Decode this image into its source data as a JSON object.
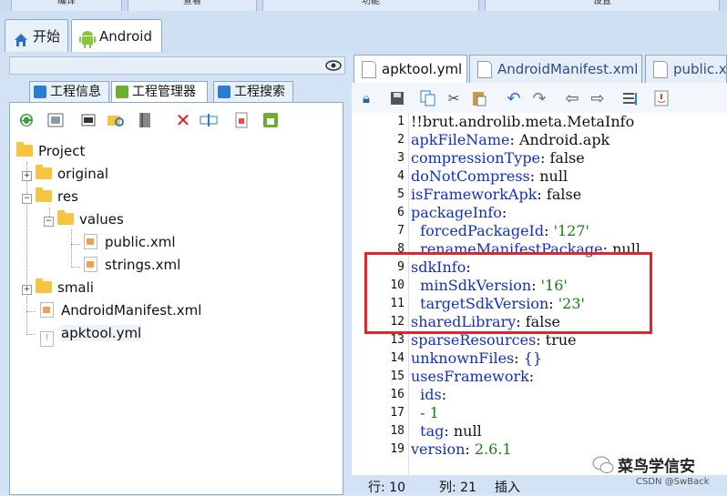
{
  "menu": [
    "编译",
    "查看",
    "功能",
    "设置"
  ],
  "main_tabs": [
    {
      "label": "开始",
      "icon": "home-icon"
    },
    {
      "label": "Android",
      "icon": "android-icon"
    }
  ],
  "left_subtabs": [
    {
      "label": "工程信息",
      "icon": "info-icon"
    },
    {
      "label": "工程管理器",
      "icon": "android-icon"
    },
    {
      "label": "工程搜索",
      "icon": "search-icon"
    }
  ],
  "tree_toolbar_icons": [
    "refresh-icon",
    "image-icon",
    "window-icon",
    "folder-search-icon",
    "book-icon",
    "delete-icon",
    "rename-icon",
    "document-icon",
    "android-icon"
  ],
  "tree": {
    "root": "Project",
    "original": "original",
    "res": "res",
    "values": "values",
    "public": "public.xml",
    "strings": "strings.xml",
    "smali": "smali",
    "manifest": "AndroidManifest.xml",
    "apktool": "apktool.yml"
  },
  "editor_tabs": [
    {
      "label": "apktool.yml",
      "active": true
    },
    {
      "label": "AndroidManifest.xml",
      "active": false
    },
    {
      "label": "public.xml",
      "active": false
    }
  ],
  "editor_toolbar_icons": [
    "lock-icon",
    "save-icon",
    "copy-icon",
    "cut-icon",
    "paste-icon",
    "undo-icon",
    "redo-icon",
    "back-icon",
    "forward-icon",
    "format-icon",
    "java-icon"
  ],
  "code_lines": [
    {
      "n": "1",
      "t": "!!brut.androlib.meta.MetaInfo"
    },
    {
      "n": "2",
      "t": "apkFileName: Android.apk"
    },
    {
      "n": "3",
      "t": "compressionType: false"
    },
    {
      "n": "4",
      "t": "doNotCompress: null"
    },
    {
      "n": "5",
      "t": "isFrameworkApk: false"
    },
    {
      "n": "6",
      "t": "packageInfo:"
    },
    {
      "n": "7",
      "t": "  forcedPackageId: '127'"
    },
    {
      "n": "8",
      "t": "  renameManifestPackage: null"
    },
    {
      "n": "9",
      "t": "sdkInfo:"
    },
    {
      "n": "10",
      "t": "  minSdkVersion: '16'"
    },
    {
      "n": "11",
      "t": "  targetSdkVersion: '23'"
    },
    {
      "n": "12",
      "t": "sharedLibrary: false"
    },
    {
      "n": "13",
      "t": "sparseResources: true"
    },
    {
      "n": "14",
      "t": "unknownFiles: {}"
    },
    {
      "n": "15",
      "t": "usesFramework:"
    },
    {
      "n": "16",
      "t": "  ids:"
    },
    {
      "n": "17",
      "t": "  - 1"
    },
    {
      "n": "18",
      "t": "  tag: null"
    },
    {
      "n": "19",
      "t": "version: 2.6.1"
    }
  ],
  "status": {
    "row": "行: 10",
    "col": "列: 21",
    "mode": "插入"
  },
  "watermark": {
    "brand": "菜鸟学信安",
    "credit": "CSDN @SwBack"
  },
  "colors": {
    "highlight": "#e3242b",
    "keyword": "#1030c0",
    "string": "#108010"
  }
}
